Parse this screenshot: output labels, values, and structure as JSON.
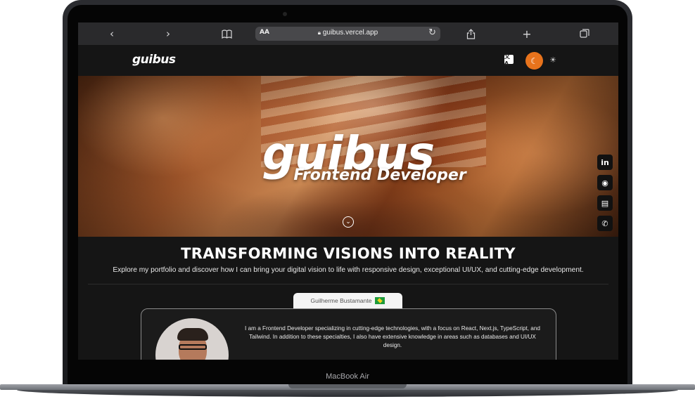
{
  "device": {
    "brand_label": "MacBook Air"
  },
  "browser": {
    "url": "guibus.vercel.app",
    "text_size_label": "AA",
    "icons": [
      "chevron-left-icon",
      "chevron-right-icon",
      "book-icon",
      "lock-icon",
      "reload-icon",
      "share-icon",
      "plus-icon",
      "tabs-icon"
    ]
  },
  "site": {
    "logo": "guibus",
    "translate_label": "文A",
    "accent_color": "#e8731c"
  },
  "hero": {
    "title": "guibus",
    "subtitle": "Frontend Developer"
  },
  "social": [
    {
      "name": "linkedin",
      "glyph": "in"
    },
    {
      "name": "github",
      "glyph": "◉"
    },
    {
      "name": "resume",
      "glyph": "▤"
    },
    {
      "name": "whatsapp",
      "glyph": "✆"
    }
  ],
  "intro": {
    "heading": "TRANSFORMING VISIONS INTO REALITY",
    "description": "Explore my portfolio and discover how I can bring your digital vision to life with responsive design, exceptional UI/UX, and cutting-edge development."
  },
  "profile": {
    "name": "Guilherme Bustamante",
    "bio": "I am a Frontend Developer specializing in cutting-edge technologies, with a focus on React, Next.js, TypeScript, and Tailwind. In addition to these specialties, I also have extensive knowledge in areas such as databases and UI/UX design."
  }
}
